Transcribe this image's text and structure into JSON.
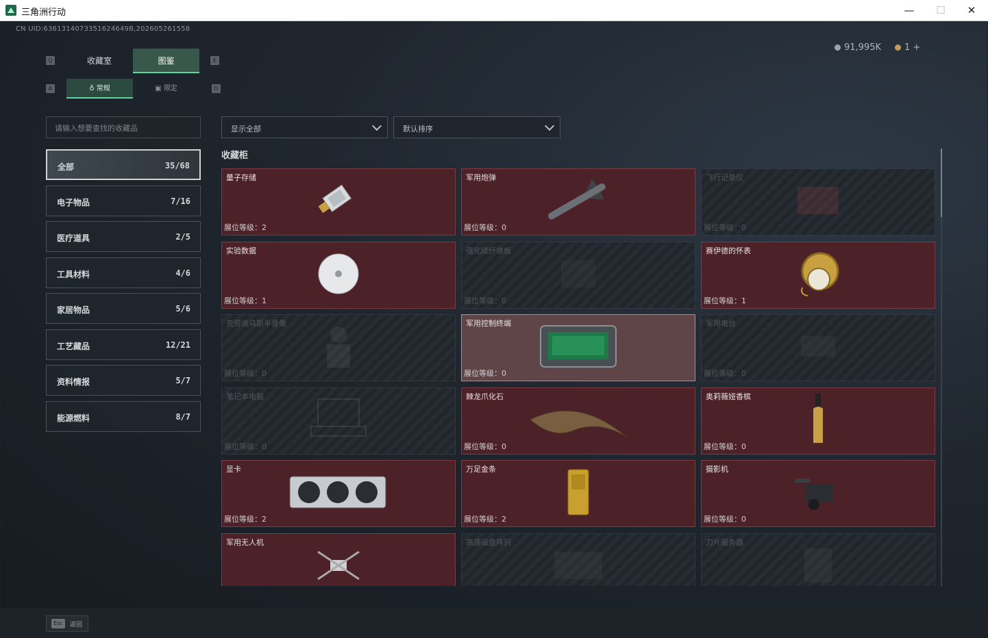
{
  "window": {
    "title": "三角洲行动",
    "minimize": "—",
    "maximize": "☐",
    "close": "✕"
  },
  "uid": "CN UID:6361314073351624649B,202605261558",
  "currency": {
    "silver": "91,995K",
    "coin": "1",
    "plus": "+"
  },
  "keys": {
    "q": "Q",
    "e": "E",
    "a": "A",
    "d": "D"
  },
  "tabs": [
    "收藏室",
    "图鉴"
  ],
  "subtabs": [
    "常规",
    "限定"
  ],
  "search_placeholder": "请输入想要查找的收藏品",
  "categories": [
    {
      "name": "全部",
      "count": "35/68"
    },
    {
      "name": "电子物品",
      "count": "7/16"
    },
    {
      "name": "医疗道具",
      "count": "2/5"
    },
    {
      "name": "工具材料",
      "count": "4/6"
    },
    {
      "name": "家居物品",
      "count": "5/6"
    },
    {
      "name": "工艺藏品",
      "count": "12/21"
    },
    {
      "name": "资料情报",
      "count": "5/7"
    },
    {
      "name": "能源燃料",
      "count": "8/7"
    }
  ],
  "filter": "显示全部",
  "sort": "默认排序",
  "section": "收藏柜",
  "level_label": "展位等级：",
  "items": [
    {
      "name": "量子存储",
      "level": "2",
      "owned": true,
      "icon": "usb-drive-icon"
    },
    {
      "name": "军用炮弹",
      "level": "0",
      "owned": true,
      "icon": "missile-icon"
    },
    {
      "name": "飞行记录仪",
      "level": "0",
      "owned": false,
      "icon": "flight-recorder-icon"
    },
    {
      "name": "实验数据",
      "level": "1",
      "owned": true,
      "icon": "disc-icon"
    },
    {
      "name": "强化碳纤维板",
      "level": "0",
      "owned": false,
      "icon": "panel-icon"
    },
    {
      "name": "赛伊德的怀表",
      "level": "1",
      "owned": true,
      "icon": "pocket-watch-icon"
    },
    {
      "name": "克劳迪乌斯半身像",
      "level": "0",
      "owned": false,
      "icon": "bust-icon"
    },
    {
      "name": "军用控制终端",
      "level": "0",
      "owned": true,
      "icon": "terminal-icon",
      "selected": true
    },
    {
      "name": "军用电台",
      "level": "0",
      "owned": false,
      "icon": "radio-icon"
    },
    {
      "name": "笔记本电脑",
      "level": "0",
      "owned": false,
      "icon": "laptop-icon"
    },
    {
      "name": "棘龙爪化石",
      "level": "0",
      "owned": true,
      "icon": "claw-fossil-icon"
    },
    {
      "name": "奥莉薇娅香槟",
      "level": "0",
      "owned": true,
      "icon": "champagne-icon"
    },
    {
      "name": "显卡",
      "level": "2",
      "owned": true,
      "icon": "gpu-icon"
    },
    {
      "name": "万足金条",
      "level": "2",
      "owned": true,
      "icon": "gold-bar-icon"
    },
    {
      "name": "摄影机",
      "level": "0",
      "owned": true,
      "icon": "camera-icon"
    },
    {
      "name": "军用无人机",
      "level": "",
      "owned": true,
      "icon": "drone-icon"
    },
    {
      "name": "高速磁盘阵列",
      "level": "",
      "owned": false,
      "icon": "disk-array-icon"
    },
    {
      "name": "刀片服务器",
      "level": "",
      "owned": false,
      "icon": "server-icon"
    }
  ],
  "esc": {
    "key": "Esc",
    "label": "返回"
  }
}
